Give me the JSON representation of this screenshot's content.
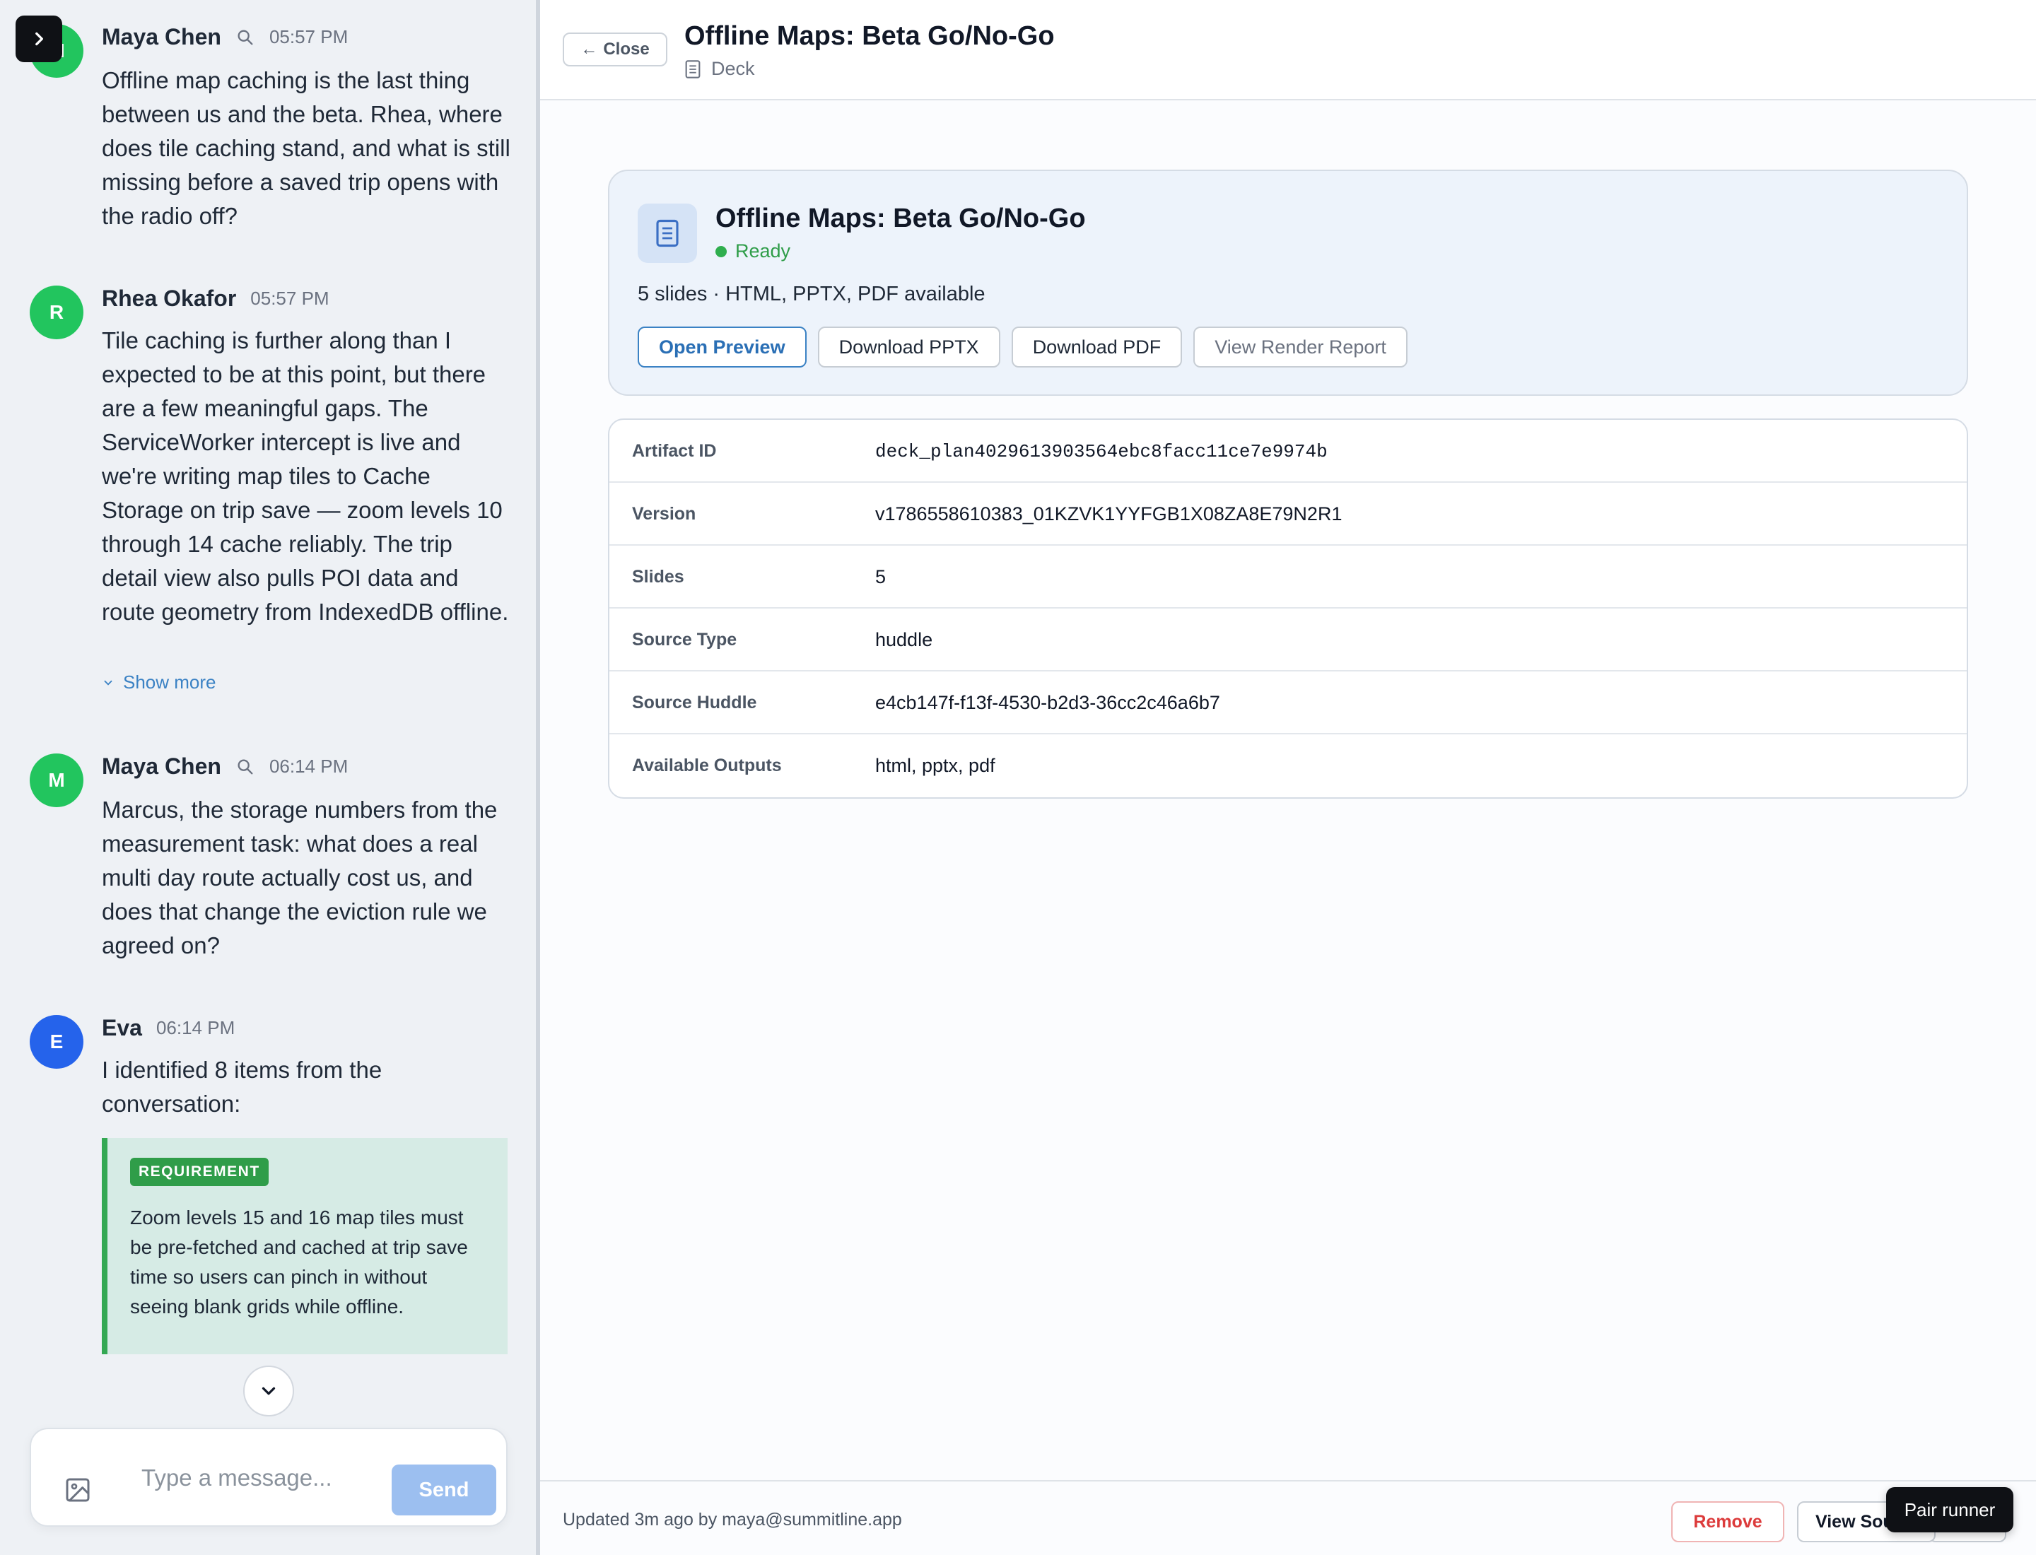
{
  "chat": {
    "messages": [
      {
        "author": "Maya Chen",
        "time": "05:57 PM",
        "avatar_letter": "M",
        "avatar_color": "#22c55e",
        "text": "Offline map caching is the last thing between us and the beta. Rhea, where does tile caching stand, and what is still missing before a saved trip opens with the radio off?"
      },
      {
        "author": "Rhea Okafor",
        "time": "05:57 PM",
        "avatar_letter": "R",
        "avatar_color": "#22c55e",
        "text": "Tile caching is further along than I expected to be at this point, but there are a few meaningful gaps. The ServiceWorker intercept is live and we're writing map tiles to Cache Storage on trip save — zoom levels 10 through 14 cache reliably. The trip detail view also pulls POI data and route geometry from IndexedDB offline.",
        "show_more": "Show more"
      },
      {
        "author": "Maya Chen",
        "time": "06:14 PM",
        "avatar_letter": "M",
        "avatar_color": "#22c55e",
        "text": "Marcus, the storage numbers from the measurement task: what does a real multi day route actually cost us, and does that change the eviction rule we agreed on?"
      },
      {
        "author": "Eva",
        "time": "06:14 PM",
        "avatar_letter": "E",
        "avatar_color": "#2563eb",
        "text": "I identified 8 items from the conversation:"
      }
    ],
    "requirement": {
      "badge": "REQUIREMENT",
      "text": "Zoom levels 15 and 16 map tiles must be pre-fetched and cached at trip save time so users can pinch in without seeing blank grids while offline."
    },
    "composer": {
      "placeholder": "Type a message...",
      "send_label": "Send"
    }
  },
  "detail": {
    "close_label": "Close",
    "title": "Offline Maps: Beta Go/No-Go",
    "kind": "Deck",
    "card": {
      "title": "Offline Maps: Beta Go/No-Go",
      "status": "Ready",
      "summary": "5 slides · HTML, PPTX, PDF available",
      "actions": {
        "open_preview": "Open Preview",
        "download_pptx": "Download PPTX",
        "download_pdf": "Download PDF",
        "view_render_report": "View Render Report"
      }
    },
    "meta": [
      {
        "key": "Artifact ID",
        "value": "deck_plan4029613903564ebc8facc11ce7e9974b"
      },
      {
        "key": "Version",
        "value": "v1786558610383_01KZVK1YYFGB1X08ZA8E79N2R1"
      },
      {
        "key": "Slides",
        "value": "5"
      },
      {
        "key": "Source Type",
        "value": "huddle"
      },
      {
        "key": "Source Huddle",
        "value": "e4cb147f-f13f-4530-b2d3-36cc2c46a6b7"
      },
      {
        "key": "Available Outputs",
        "value": "html, pptx, pdf"
      }
    ],
    "footer": {
      "updated": "Updated 3m ago by maya@summitline.app",
      "remove_label": "Remove",
      "view_source_label": "View Source"
    }
  },
  "tooltip": {
    "pair_runner": "Pair runner"
  },
  "colors": {
    "accent": "#3b82c4",
    "ready": "#2f9d49",
    "danger": "#dc3b3b"
  }
}
